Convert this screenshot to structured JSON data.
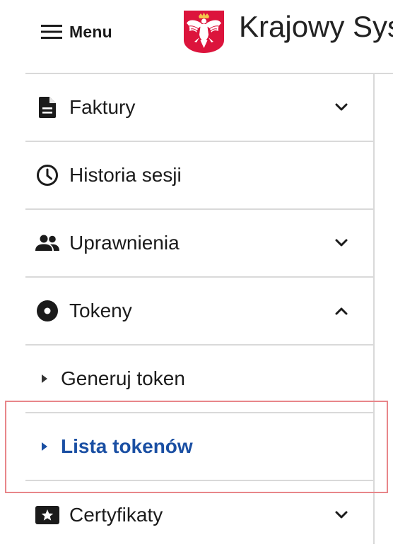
{
  "header": {
    "menu_label": "Menu",
    "system_title": "Krajowy Sys",
    "logo_name": "polish-eagle-emblem"
  },
  "sidebar": {
    "items": [
      {
        "label": "Faktury",
        "icon": "document-icon",
        "chevron": "down"
      },
      {
        "label": "Historia sesji",
        "icon": "clock-icon",
        "chevron": null
      },
      {
        "label": "Uprawnienia",
        "icon": "people-icon",
        "chevron": "down"
      },
      {
        "label": "Tokeny",
        "icon": "disc-icon",
        "chevron": "up"
      },
      {
        "label": "Generuj token",
        "sub": true,
        "active": false
      },
      {
        "label": "Lista tokenów",
        "sub": true,
        "active": true
      },
      {
        "label": "Certyfikaty",
        "icon": "certificate-icon",
        "chevron": "down"
      }
    ]
  },
  "colors": {
    "active_link": "#1a4fa3",
    "highlight_border": "#e8868a",
    "emblem_red": "#dc143c"
  }
}
